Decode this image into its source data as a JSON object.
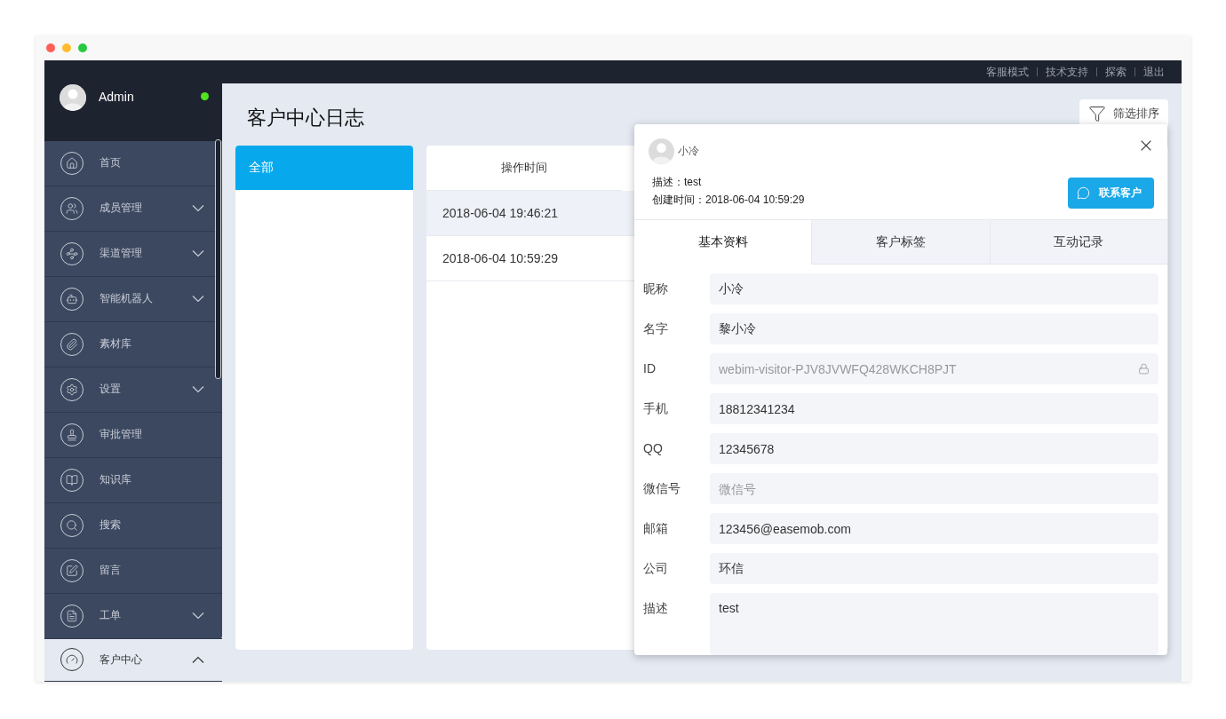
{
  "top_links": [
    "客服模式",
    "技术支持",
    "探索",
    "退出"
  ],
  "user": {
    "name": "Admin",
    "online": true
  },
  "sidebar": {
    "items": [
      {
        "label": "首页",
        "kind": "link"
      },
      {
        "label": "成员管理",
        "kind": "group",
        "expanded": false
      },
      {
        "label": "渠道管理",
        "kind": "group",
        "expanded": false
      },
      {
        "label": "智能机器人",
        "kind": "group",
        "expanded": false
      },
      {
        "label": "素材库",
        "kind": "link"
      },
      {
        "label": "设置",
        "kind": "group",
        "expanded": false
      },
      {
        "label": "审批管理",
        "kind": "link"
      },
      {
        "label": "知识库",
        "kind": "link"
      },
      {
        "label": "搜索",
        "kind": "link"
      },
      {
        "label": "留言",
        "kind": "link"
      },
      {
        "label": "工单",
        "kind": "group",
        "expanded": false
      },
      {
        "label": "客户中心",
        "kind": "group",
        "expanded": true
      }
    ]
  },
  "page_title": "客户中心日志",
  "filter_button": "筛选排序",
  "categories": [
    {
      "label": "全部",
      "selected": true
    }
  ],
  "table": {
    "columns": [
      "操作时间"
    ],
    "rows": [
      {
        "cells": [
          "2018-06-04 19:46:21"
        ],
        "selected": true
      },
      {
        "cells": [
          "2018-06-04 10:59:29"
        ],
        "selected": false
      }
    ]
  },
  "customer_panel": {
    "name": "小冷",
    "description": "描述：test",
    "created": "创建时间：2018-06-04 10:59:29",
    "contact_button": "联系客户",
    "tabs": [
      {
        "label": "基本资料",
        "selected": true
      },
      {
        "label": "客户标签",
        "selected": false
      },
      {
        "label": "互动记录",
        "selected": false
      }
    ],
    "fields": [
      {
        "label": "昵称",
        "kind": "input",
        "value": "小冷"
      },
      {
        "label": "名字",
        "kind": "input",
        "value": "黎小冷"
      },
      {
        "label": "ID",
        "kind": "locked",
        "value": "webim-visitor-PJV8JVWFQ428WKCH8PJT"
      },
      {
        "label": "手机",
        "kind": "input",
        "value": "18812341234"
      },
      {
        "label": "QQ",
        "kind": "input",
        "value": "12345678"
      },
      {
        "label": "微信号",
        "kind": "input",
        "placeholder": "微信号"
      },
      {
        "label": "邮箱",
        "kind": "input",
        "value": "123456@easemob.com"
      },
      {
        "label": "公司",
        "kind": "input",
        "value": "环信"
      },
      {
        "label": "描述",
        "kind": "textarea",
        "value": "test"
      }
    ]
  }
}
